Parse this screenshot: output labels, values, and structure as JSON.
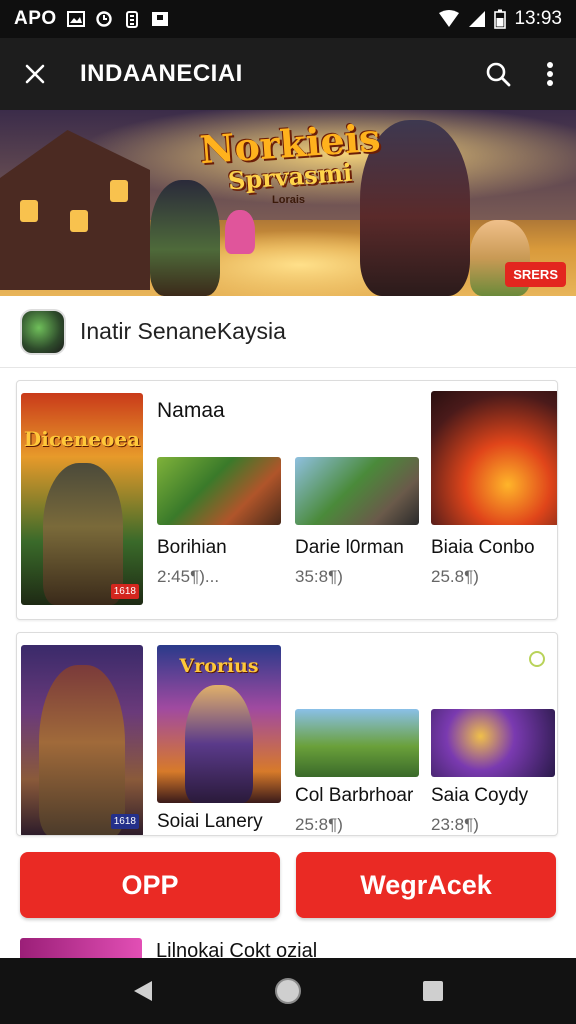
{
  "status_bar": {
    "carrier": "APO",
    "time": "13:93",
    "icons": [
      "gallery-icon",
      "sync-icon",
      "battery-saver-icon",
      "photo-icon"
    ]
  },
  "app_bar": {
    "title": "INDAANECIAI",
    "close_icon": "close-icon",
    "search_icon": "search-icon",
    "menu_icon": "more-vert-icon"
  },
  "banner": {
    "title": "Norkieis",
    "subtitle": "Sprvasmi",
    "small_text": "Lorais",
    "badge": "SRERS"
  },
  "app": {
    "name": "Inatir SenaneKaysia"
  },
  "card1": {
    "poster_title": "Diceneoea",
    "poster_tag": "1618",
    "heading": "Namaa",
    "games": [
      {
        "name": "Borihian",
        "meta": "2:45¶)..."
      },
      {
        "name": "Darie l0rman",
        "meta": "35:8¶)"
      },
      {
        "name": "Biaia Conbo",
        "meta": "25.8¶)"
      }
    ]
  },
  "card2": {
    "poster_title": "Vrorius",
    "poster_tag": "1618",
    "heading": "Soiai Lanery",
    "games": [
      {
        "name": "Col Barbrhoar",
        "meta": "25:8¶)"
      },
      {
        "name": "Saia Coydy",
        "meta": "23:8¶)"
      }
    ]
  },
  "buttons": {
    "left": "OPP",
    "right": "WegrAcek"
  },
  "peek": {
    "text": "Lilnokai Cokt ozial"
  },
  "colors": {
    "accent": "#ea2a24",
    "app_bar": "#1d1d1d",
    "status_bar": "#0f0f0f"
  }
}
